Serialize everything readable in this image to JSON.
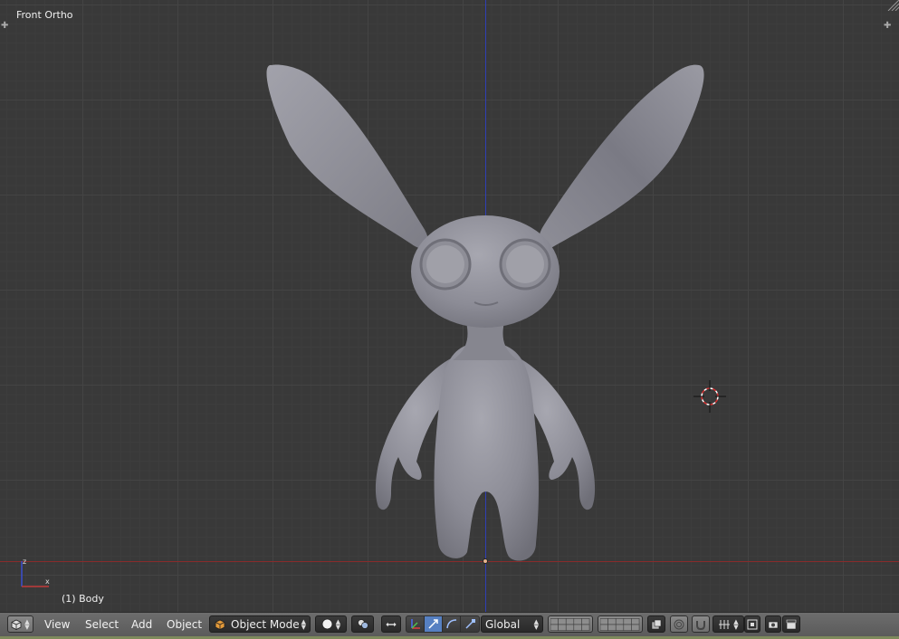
{
  "viewport": {
    "view_label": "Front Ortho",
    "object_label": "(1) Body"
  },
  "header": {
    "menus": {
      "view": "View",
      "select": "Select",
      "add": "Add",
      "object": "Object"
    },
    "mode": "Object Mode",
    "orientation": "Global"
  },
  "icons": {
    "editor_type": "cube-editor-icon",
    "mode": "object-mode-cube-icon",
    "shading": "solid-sphere-icon",
    "pivot": "pivot-icon",
    "manipulator": "manipulator-toggle-icon",
    "translate": "translate-arrow-icon",
    "rotate": "rotate-arc-icon",
    "scale": "scale-icon"
  },
  "colors": {
    "viewport_bg": "#393939",
    "x_axis": "#8a2b2b",
    "z_axis": "#2f3fb5",
    "header_bg": "#6d6d6d",
    "active_button": "#5680c2",
    "model": "#8f8f99"
  }
}
